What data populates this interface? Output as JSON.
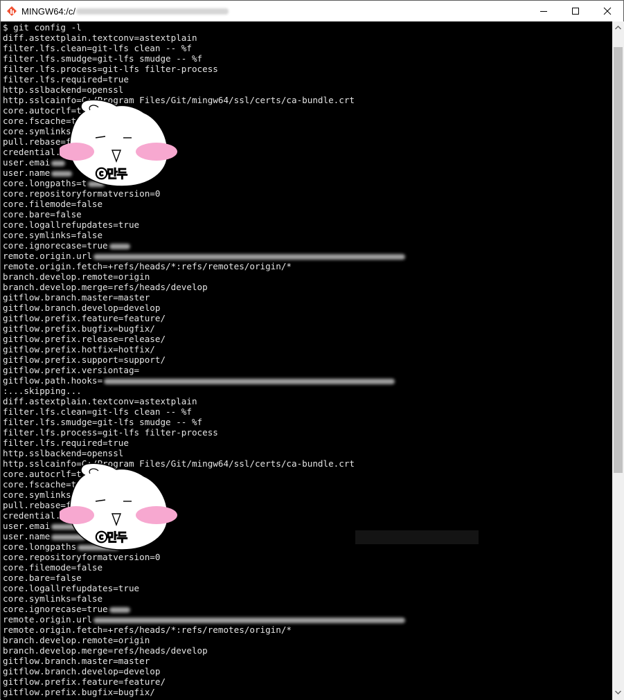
{
  "window": {
    "title": "MINGW64:/c/",
    "controls": {
      "minimize": "─",
      "maximize": "☐",
      "close": "✕"
    }
  },
  "terminal": {
    "lines": [
      "$ git config -l",
      "diff.astextplain.textconv=astextplain",
      "filter.lfs.clean=git-lfs clean -- %f",
      "filter.lfs.smudge=git-lfs smudge -- %f",
      "filter.lfs.process=git-lfs filter-process",
      "filter.lfs.required=true",
      "http.sslbackend=openssl",
      "http.sslcainfo=C:/Program Files/Git/mingw64/ssl/certs/ca-bundle.crt",
      "core.autocrlf=true",
      "core.fscache=true",
      "core.symlinks=false",
      "pull.rebase=false",
      "credential.h",
      "user.emai",
      "user.name",
      "core.longpaths=t",
      "core.repositoryformatversion=0",
      "core.filemode=false",
      "core.bare=false",
      "core.logallrefupdates=true",
      "core.symlinks=false",
      "core.ignorecase=true",
      "remote.origin.url",
      "remote.origin.fetch=+refs/heads/*:refs/remotes/origin/*",
      "branch.develop.remote=origin",
      "branch.develop.merge=refs/heads/develop",
      "gitflow.branch.master=master",
      "gitflow.branch.develop=develop",
      "gitflow.prefix.feature=feature/",
      "gitflow.prefix.bugfix=bugfix/",
      "gitflow.prefix.release=release/",
      "gitflow.prefix.hotfix=hotfix/",
      "gitflow.prefix.support=support/",
      "gitflow.prefix.versiontag=",
      "gitflow.path.hooks=",
      ":...skipping...",
      "diff.astextplain.textconv=astextplain",
      "filter.lfs.clean=git-lfs clean -- %f",
      "filter.lfs.smudge=git-lfs smudge -- %f",
      "filter.lfs.process=git-lfs filter-process",
      "filter.lfs.required=true",
      "http.sslbackend=openssl",
      "http.sslcainfo=C:/Program Files/Git/mingw64/ssl/certs/ca-bundle.crt",
      "core.autocrlf=true",
      "core.fscache=true",
      "core.symlinks=false",
      "pull.rebase=false",
      "credential.h",
      "user.emai",
      "user.name",
      "core.longpaths",
      "core.repositoryformatversion=0",
      "core.filemode=false",
      "core.bare=false",
      "core.logallrefupdates=true",
      "core.symlinks=false",
      "core.ignorecase=true",
      "remote.origin.url",
      "remote.origin.fetch=+refs/heads/*:refs/remotes/origin/*",
      "branch.develop.remote=origin",
      "branch.develop.merge=refs/heads/develop",
      "gitflow.branch.master=master",
      "gitflow.branch.develop=develop",
      "gitflow.prefix.feature=feature/",
      "gitflow.prefix.bugfix=bugfix/"
    ]
  },
  "watermark": {
    "caption": "ⓒ만두"
  },
  "colors": {
    "terminal_bg": "#000000",
    "terminal_fg": "#e4e4e4",
    "blush": "#f7a8d0"
  }
}
